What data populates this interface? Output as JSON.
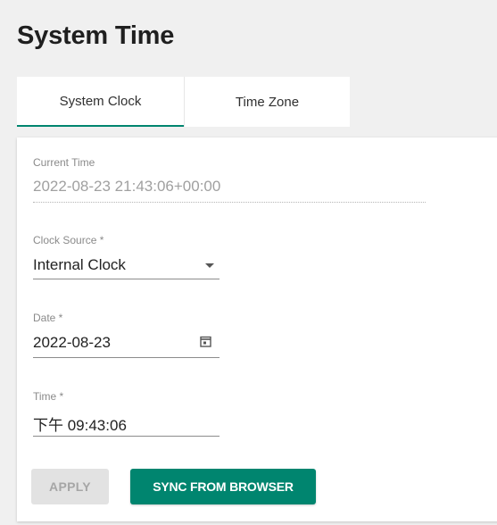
{
  "page": {
    "title": "System Time"
  },
  "tabs": [
    {
      "label": "System Clock",
      "active": true
    },
    {
      "label": "Time Zone",
      "active": false
    }
  ],
  "form": {
    "current_time": {
      "label": "Current Time",
      "value": "2022-08-23 21:43:06+00:00"
    },
    "clock_source": {
      "label": "Clock Source *",
      "value": "Internal Clock"
    },
    "date": {
      "label": "Date *",
      "value": "2022-08-23"
    },
    "time": {
      "label": "Time *",
      "value": "下午 09:43:06"
    }
  },
  "buttons": {
    "apply": "APPLY",
    "sync": "SYNC FROM BROWSER"
  },
  "icons": {
    "clock_source_dropdown": "dropdown-arrow-icon",
    "date_picker": "calendar-icon"
  },
  "colors": {
    "accent": "#00856f",
    "disabled_button": "#e2e2e2",
    "background": "#f0f0f0"
  }
}
